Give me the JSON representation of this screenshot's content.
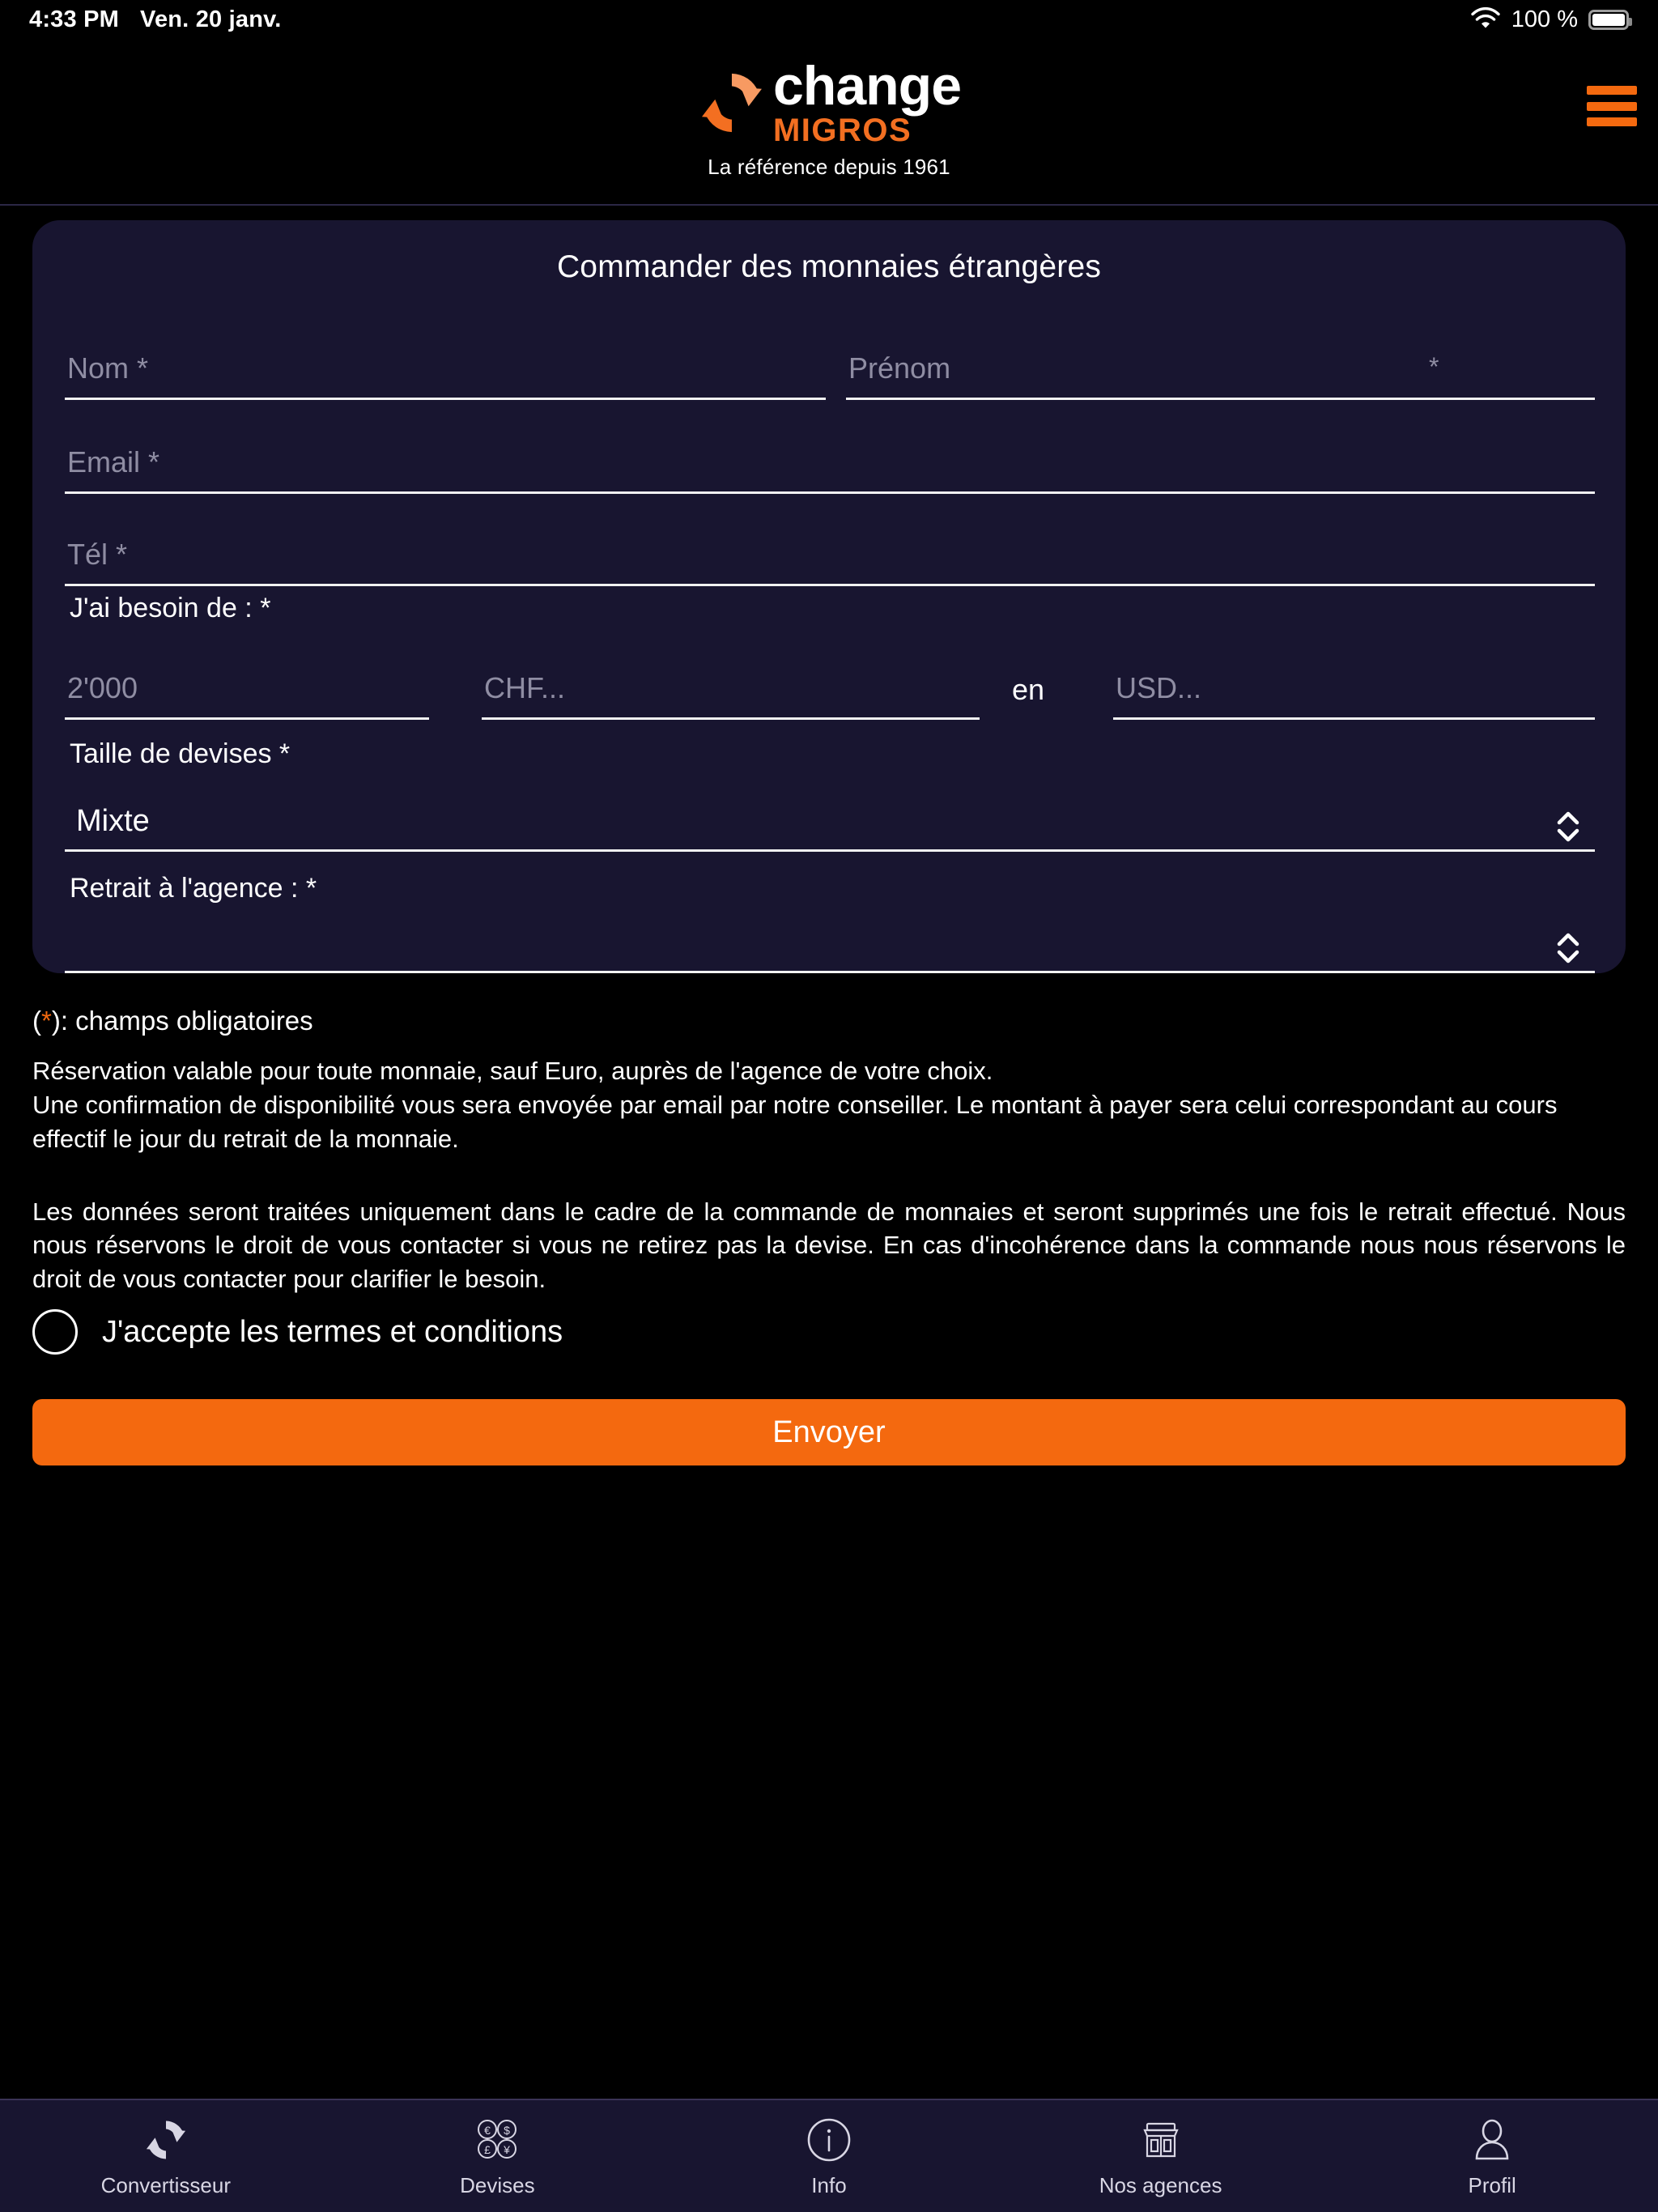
{
  "status_bar": {
    "time": "4:33 PM",
    "date": "Ven. 20 janv.",
    "battery_percent": "100 %",
    "wifi_icon": "wifi-icon",
    "battery_icon": "battery-full-icon"
  },
  "header": {
    "logo_word": "change",
    "logo_brand": "MIGROS",
    "tagline": "La référence depuis 1961",
    "menu_icon": "hamburger-menu-icon",
    "menu_color": "#f4690f"
  },
  "form": {
    "title": "Commander des monnaies étrangères",
    "nom": {
      "label": "Nom *",
      "value": "",
      "placeholder": "Nom *"
    },
    "prenom": {
      "label": "Prénom",
      "star": "*",
      "value": "",
      "placeholder": "Prénom"
    },
    "email": {
      "label": "Email *",
      "value": "",
      "placeholder": "Email *"
    },
    "tel": {
      "label": "Tél *",
      "value": "",
      "placeholder": "Tél *"
    },
    "besoin_label": "J'ai besoin de : *",
    "amount": {
      "value": "",
      "placeholder": "2'000"
    },
    "from_currency": {
      "value": "",
      "placeholder": "CHF..."
    },
    "en_word": "en",
    "to_currency": {
      "value": "",
      "placeholder": "USD..."
    },
    "taille_label": "Taille de devises *",
    "taille_value": "Mixte",
    "retrait_label": "Retrait à l'agence : *",
    "retrait_value": "",
    "select_icon": "chevron-up-down-icon"
  },
  "notes": {
    "required_prefix": "(",
    "required_star": "*",
    "required_text": "): champs obligatoires",
    "paragraph1_line1": "Réservation valable pour toute monnaie, sauf Euro, auprès de l'agence de votre choix.",
    "paragraph1_line2": "Une confirmation de disponibilité vous sera envoyée par email par notre conseiller. Le montant à payer sera celui correspondant au cours effectif le jour du retrait de la monnaie.",
    "paragraph2": "Les données seront traitées uniquement dans le cadre de la commande de monnaies et seront supprimés une fois le retrait effectué. Nous nous réservons le droit de vous contacter si vous ne retirez pas la devise. En cas d'incohérence dans la commande nous nous réservons le droit de vous contacter pour clarifier le besoin."
  },
  "terms": {
    "checkbox_icon": "checkbox-unchecked-icon",
    "checked": false,
    "label": "J'accepte les termes et conditions"
  },
  "submit": {
    "label": "Envoyer",
    "color": "#f4690f"
  },
  "tabbar": {
    "items": [
      {
        "label": "Convertisseur",
        "icon": "convert-arrows-icon",
        "active": false
      },
      {
        "label": "Devises",
        "icon": "currency-coins-icon",
        "active": false
      },
      {
        "label": "Info",
        "icon": "info-circle-icon",
        "active": false
      },
      {
        "label": "Nos agences",
        "icon": "storefront-icon",
        "active": false
      },
      {
        "label": "Profil",
        "icon": "person-icon",
        "active": false
      }
    ]
  },
  "colors": {
    "accent": "#f4690f",
    "card_bg": "#181530",
    "page_bg": "#000000",
    "placeholder": "#8f8da3"
  }
}
